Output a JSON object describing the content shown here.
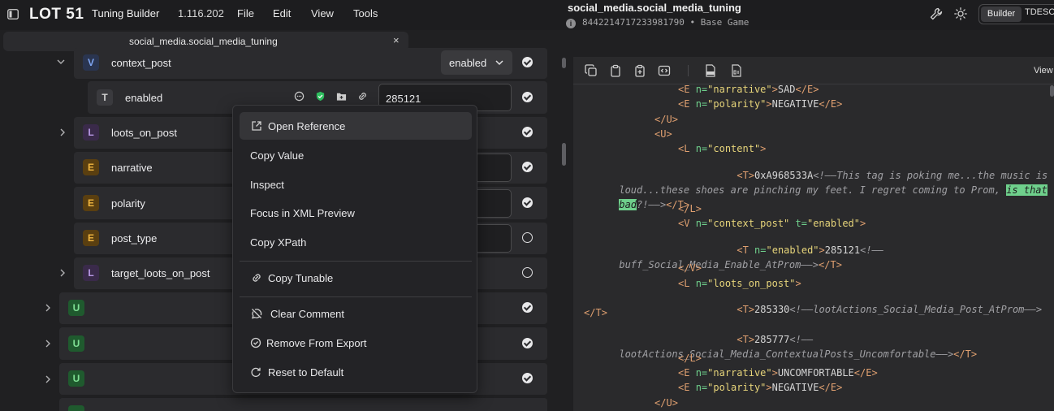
{
  "app": {
    "logo": "LOT 51",
    "name": "Tuning Builder",
    "version": "1.116.202",
    "menu": [
      "File",
      "Edit",
      "View",
      "Tools"
    ]
  },
  "document": {
    "title": "social_media.social_media_tuning",
    "instance_id": "8442214717233981790",
    "separator": "•",
    "pack": "Base Game"
  },
  "mode_toggle": {
    "active": "Builder",
    "other": "TDESC"
  },
  "tab": {
    "label": "social_media.social_media_tuning",
    "close": "×"
  },
  "tree": {
    "rows": [
      {
        "badge": "V",
        "label": "context_post",
        "dropdown": "enabled",
        "status": "checked"
      },
      {
        "badge": "T",
        "label": "enabled",
        "value": "285121",
        "status": "checked"
      },
      {
        "badge": "L",
        "label": "loots_on_post",
        "status": "checked"
      },
      {
        "badge": "E",
        "label": "narrative",
        "status": "checked"
      },
      {
        "badge": "E",
        "label": "polarity",
        "status": "checked"
      },
      {
        "badge": "E",
        "label": "post_type",
        "status": "unchecked"
      },
      {
        "badge": "L",
        "label": "target_loots_on_post",
        "status": "unchecked"
      },
      {
        "badge": "U",
        "label": "",
        "status": "checked"
      },
      {
        "badge": "U",
        "label": "",
        "status": "checked"
      },
      {
        "badge": "U",
        "label": "",
        "status": "checked"
      }
    ]
  },
  "context_menu": {
    "items": [
      {
        "label": "Open Reference",
        "icon": "external-link-icon"
      },
      {
        "label": "Copy Value",
        "icon": ""
      },
      {
        "label": "Inspect",
        "icon": ""
      },
      {
        "label": "Focus in XML Preview",
        "icon": ""
      },
      {
        "label": "Copy XPath",
        "icon": ""
      },
      {
        "label": "Copy Tunable",
        "icon": "link-icon"
      },
      {
        "label": "Clear Comment",
        "icon": "comment-off-icon"
      },
      {
        "label": "Remove From Export",
        "icon": "check-circle-icon"
      },
      {
        "label": "Reset to Default",
        "icon": "reset-icon"
      }
    ]
  },
  "xml_preview": {
    "view_label": "View",
    "lines": [
      "<E n=\"narrative\">SAD</E>",
      "<E n=\"polarity\">NEGATIVE</E>",
      "</U>",
      "<U>",
      "<L n=\"content\">",
      "<T>0xA968533A",
      "<!——This tag is poking me...the music is",
      "loud...these shoes are pinching my feet. I regret coming to Prom, ",
      "is that",
      "bad",
      "?!——>",
      "</T>",
      "</L>",
      "<V n=\"context_post\" t=\"enabled\">",
      "<T n=\"enabled\">285121",
      "<!——",
      "buff_Social_Media_Enable_AtProm——>",
      "</V>",
      "<L n=\"loots_on_post\">",
      "<T>285330",
      "<!——lootActions_Social_Media_Post_AtProm——>",
      "<T>285777",
      "lootActions_Social_Media_ContextualPosts_Uncomfortable——>",
      "<E n=\"narrative\">UNCOMFORTABLE</E>",
      "<E n=\"polarity\">NEGATIVE</E>"
    ]
  }
}
